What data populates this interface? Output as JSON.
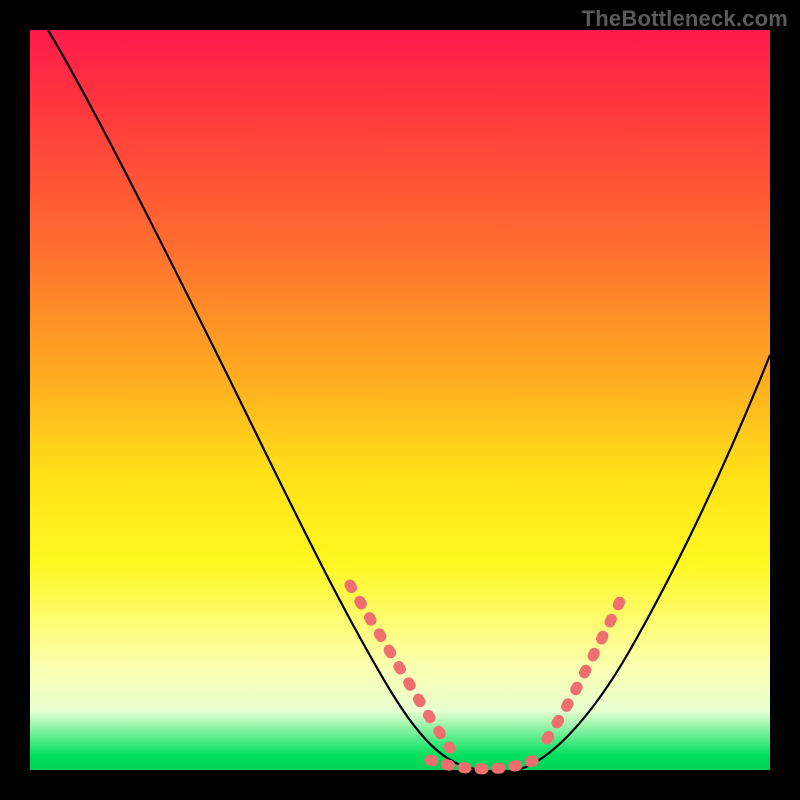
{
  "watermark": "TheBottleneck.com",
  "chart_data": {
    "type": "line",
    "title": "",
    "xlabel": "",
    "ylabel": "",
    "xlim": [
      0,
      100
    ],
    "ylim": [
      0,
      100
    ],
    "grid": false,
    "legend": false,
    "background_gradient": [
      "#ff1a4d",
      "#ffb020",
      "#fff820",
      "#00d058"
    ],
    "series": [
      {
        "name": "left-curve",
        "color": "#000000",
        "x": [
          2,
          8,
          14,
          20,
          26,
          32,
          38,
          44,
          48,
          52,
          55,
          58,
          60
        ],
        "y": [
          100,
          92,
          82,
          71,
          60,
          48,
          37,
          25,
          17,
          10,
          5,
          2,
          0
        ]
      },
      {
        "name": "right-curve",
        "color": "#000000",
        "x": [
          66,
          70,
          74,
          78,
          82,
          86,
          90,
          94,
          98,
          100
        ],
        "y": [
          0,
          4,
          10,
          17,
          25,
          33,
          40,
          47,
          53,
          56
        ]
      },
      {
        "name": "left-dotted-segment",
        "color": "#ef6f6f",
        "style": "dotted",
        "x": [
          44,
          46,
          48,
          50,
          52,
          54,
          56,
          58
        ],
        "y": [
          25,
          21,
          17,
          13,
          10,
          7,
          4,
          2
        ]
      },
      {
        "name": "bottom-dotted-segment",
        "color": "#ef6f6f",
        "style": "dotted",
        "x": [
          54,
          56,
          58,
          60,
          62,
          64,
          66
        ],
        "y": [
          1.5,
          0.8,
          0.3,
          0,
          0.2,
          0.6,
          1.2
        ]
      },
      {
        "name": "right-dotted-segment",
        "color": "#ef6f6f",
        "style": "dotted",
        "x": [
          70,
          72,
          74,
          76,
          78,
          80
        ],
        "y": [
          4,
          7,
          10,
          14,
          17,
          21
        ]
      }
    ]
  }
}
